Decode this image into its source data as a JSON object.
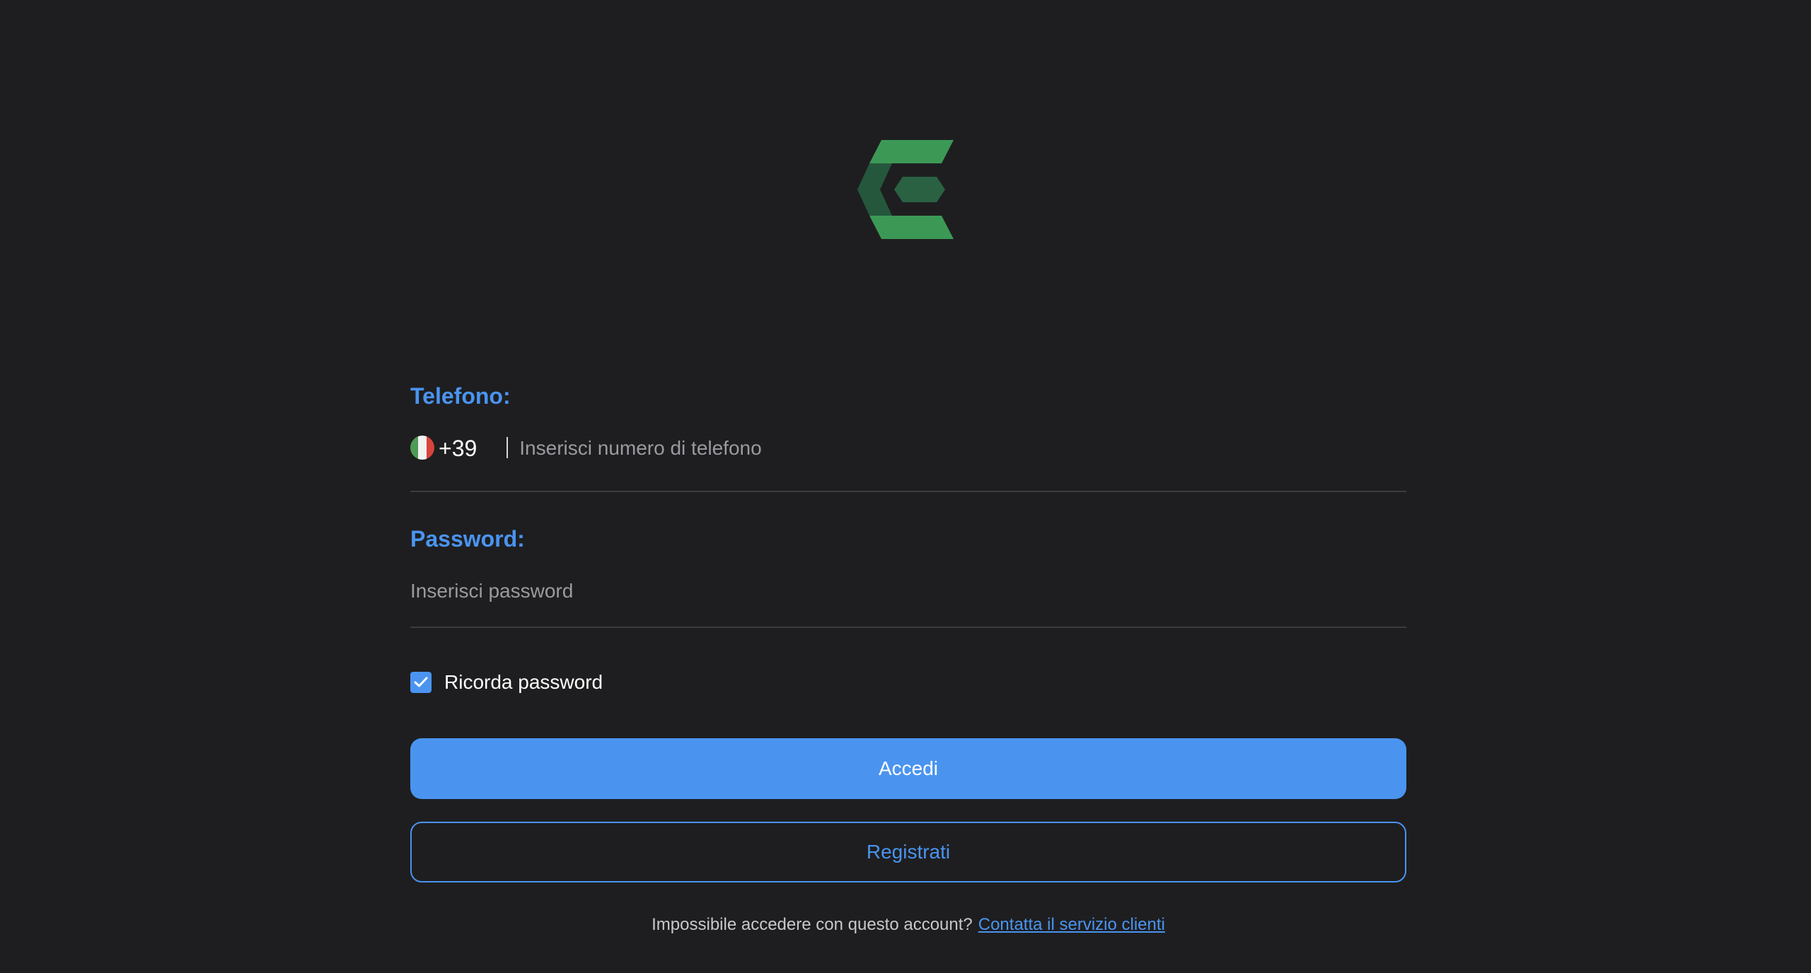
{
  "logo": {
    "icon": "brand-logo-icon",
    "colors": [
      "#2e8b48",
      "#22543a",
      "#3c9955"
    ]
  },
  "phone": {
    "label": "Telefono:",
    "country_flag": "italy-flag-icon",
    "prefix": "+39",
    "placeholder": "Inserisci numero di telefono"
  },
  "password": {
    "label": "Password:",
    "placeholder": "Inserisci password"
  },
  "remember": {
    "label": "Ricorda password",
    "checked": true
  },
  "buttons": {
    "login": "Accedi",
    "register": "Registrati"
  },
  "footer": {
    "text": "Impossibile accedere con questo account?",
    "link": "Contatta il servizio clienti"
  },
  "colors": {
    "accent": "#4a94f0",
    "background": "#1e1e20"
  }
}
